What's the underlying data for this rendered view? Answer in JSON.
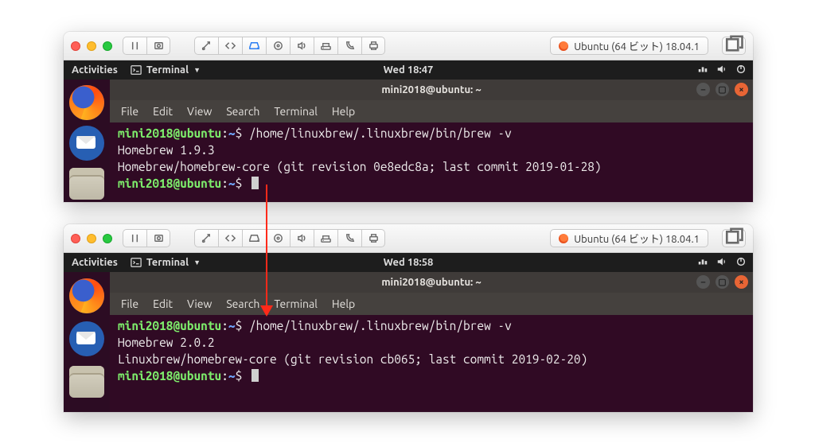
{
  "mac_tab_label": "Ubuntu (64 ビット) 18.04.1",
  "ubuntu": {
    "activities": "Activities",
    "app_label": "Terminal",
    "topbar_icons": [
      "network-icon",
      "volume-icon",
      "power-icon"
    ]
  },
  "menubar": [
    "File",
    "Edit",
    "View",
    "Search",
    "Terminal",
    "Help"
  ],
  "sessions": [
    {
      "clock": "Wed 18:47",
      "title": "mini2018@ubuntu: ~",
      "prompt_user": "mini2018@ubuntu",
      "prompt_path": "~",
      "command": "/home/linuxbrew/.linuxbrew/bin/brew -v",
      "output": [
        "Homebrew 1.9.3",
        "Homebrew/homebrew-core (git revision 0e8edc8a; last commit 2019-01-28)"
      ]
    },
    {
      "clock": "Wed 18:58",
      "title": "mini2018@ubuntu: ~",
      "prompt_user": "mini2018@ubuntu",
      "prompt_path": "~",
      "command": "/home/linuxbrew/.linuxbrew/bin/brew -v",
      "output": [
        "Homebrew 2.0.2",
        "Linuxbrew/homebrew-core (git revision cb065; last commit 2019-02-20)"
      ]
    }
  ]
}
